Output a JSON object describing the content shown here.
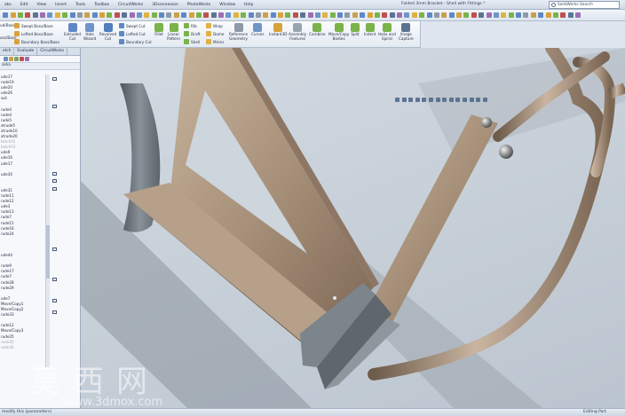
{
  "menu": [
    "aks",
    "Edit",
    "View",
    "Insert",
    "Tools",
    "Toolbox",
    "CircuitWorks",
    "3Dconnexion",
    "PhotoWorks",
    "Window",
    "Help"
  ],
  "window_title": "Folded 3mm Bracket - Shell with Fittings *",
  "search": {
    "placeholder": "SolidWorks Search"
  },
  "ribbon": {
    "left_cut": [
      "ud/Base",
      "oss/Base"
    ],
    "swept_boss": "Swept Boss/Base",
    "lofted_boss": "Lofted Boss/Base",
    "boundary_boss": "Boundary Boss/Base",
    "extruded_cut": [
      "Extruded",
      "Cut"
    ],
    "hole_wizard": [
      "Hole",
      "Wizard"
    ],
    "revolved_cut": [
      "Revolved",
      "Cut"
    ],
    "swept_cut": "Swept Cut",
    "lofted_cut": "Lofted Cut",
    "boundary_cut": "Boundary Cut",
    "fillet": "Fillet",
    "linear_pattern": [
      "Linear",
      "Pattern"
    ],
    "rib": "Rib",
    "draft": "Draft",
    "shell": "Shell",
    "wrap": "Wrap",
    "dome": "Dome",
    "mirror": "Mirror",
    "reference_geometry": [
      "Reference",
      "Geometry"
    ],
    "curves": "Curves",
    "instant3d": "Instant3D",
    "assembly_features": [
      "Assembly",
      "Features"
    ],
    "combine": "Combine",
    "move_copy": [
      "Move/Copy",
      "Bodies"
    ],
    "split": "Split",
    "indent": "Indent",
    "helix": [
      "Helix and",
      "Spiral"
    ],
    "image_capture": [
      "Image",
      "Capture"
    ]
  },
  "panel": {
    "tabs": [
      "etch",
      "Evaluate",
      "CircuitWorks"
    ],
    "tree_header": "aska",
    "tree_items": [
      {
        "label": "ude17",
        "dim": false
      },
      {
        "label": "rude19",
        "dim": false
      },
      {
        "label": "ude20",
        "dim": false
      },
      {
        "label": "ude26",
        "dim": false
      },
      {
        "label": "ss4",
        "dim": false
      },
      {
        "label": "",
        "dim": false
      },
      {
        "label": "rude4",
        "dim": false
      },
      {
        "label": "rude4",
        "dim": false
      },
      {
        "label": "rude5",
        "dim": false
      },
      {
        "label": "xtrude5",
        "dim": false
      },
      {
        "label": "xtrude10",
        "dim": false
      },
      {
        "label": "xtrude20",
        "dim": false
      },
      {
        "label": "ketch52",
        "dim": true
      },
      {
        "label": "ketch53",
        "dim": true
      },
      {
        "label": "ude9",
        "dim": false
      },
      {
        "label": "ude16",
        "dim": false
      },
      {
        "label": "ude17",
        "dim": false
      },
      {
        "label": "",
        "dim": false
      },
      {
        "label": "ude30",
        "dim": false
      },
      {
        "label": "",
        "dim": false
      },
      {
        "label": "",
        "dim": false
      },
      {
        "label": "ude31",
        "dim": false
      },
      {
        "label": "rude11",
        "dim": false
      },
      {
        "label": "rude12",
        "dim": false
      },
      {
        "label": "ude3",
        "dim": false
      },
      {
        "label": "rude13",
        "dim": false
      },
      {
        "label": "rude7",
        "dim": false
      },
      {
        "label": "rude15",
        "dim": false
      },
      {
        "label": "rude16",
        "dim": false
      },
      {
        "label": "rude24",
        "dim": false
      },
      {
        "label": "",
        "dim": false
      },
      {
        "label": "",
        "dim": false
      },
      {
        "label": "",
        "dim": false
      },
      {
        "label": "ude44",
        "dim": false
      },
      {
        "label": "",
        "dim": false
      },
      {
        "label": "rude9",
        "dim": false
      },
      {
        "label": "rude17",
        "dim": false
      },
      {
        "label": "rude7",
        "dim": false
      },
      {
        "label": "rude28",
        "dim": false
      },
      {
        "label": "rude29",
        "dim": false
      },
      {
        "label": "",
        "dim": false
      },
      {
        "label": "ude7",
        "dim": false
      },
      {
        "label": "Move/Copy1",
        "dim": false
      },
      {
        "label": "Move/Copy2",
        "dim": false
      },
      {
        "label": "rude33",
        "dim": false
      },
      {
        "label": "",
        "dim": false
      },
      {
        "label": "rude12",
        "dim": false
      },
      {
        "label": "Move/Copy3",
        "dim": false
      },
      {
        "label": "rude35",
        "dim": false
      },
      {
        "label": "rude35",
        "dim": true
      },
      {
        "label": "rude36",
        "dim": true
      }
    ]
  },
  "status": {
    "left": "modify this (parameters)",
    "right": "Editing Part"
  },
  "watermark": {
    "chars": "莫西网",
    "url": "www.3dmox.com"
  },
  "model": {
    "colors": {
      "metal": "#a8917a",
      "metal_dark": "#6e5c4b",
      "metal_light": "#c9b5a0",
      "shadow": "#7f8790",
      "gray_part": "#6d747c"
    }
  }
}
